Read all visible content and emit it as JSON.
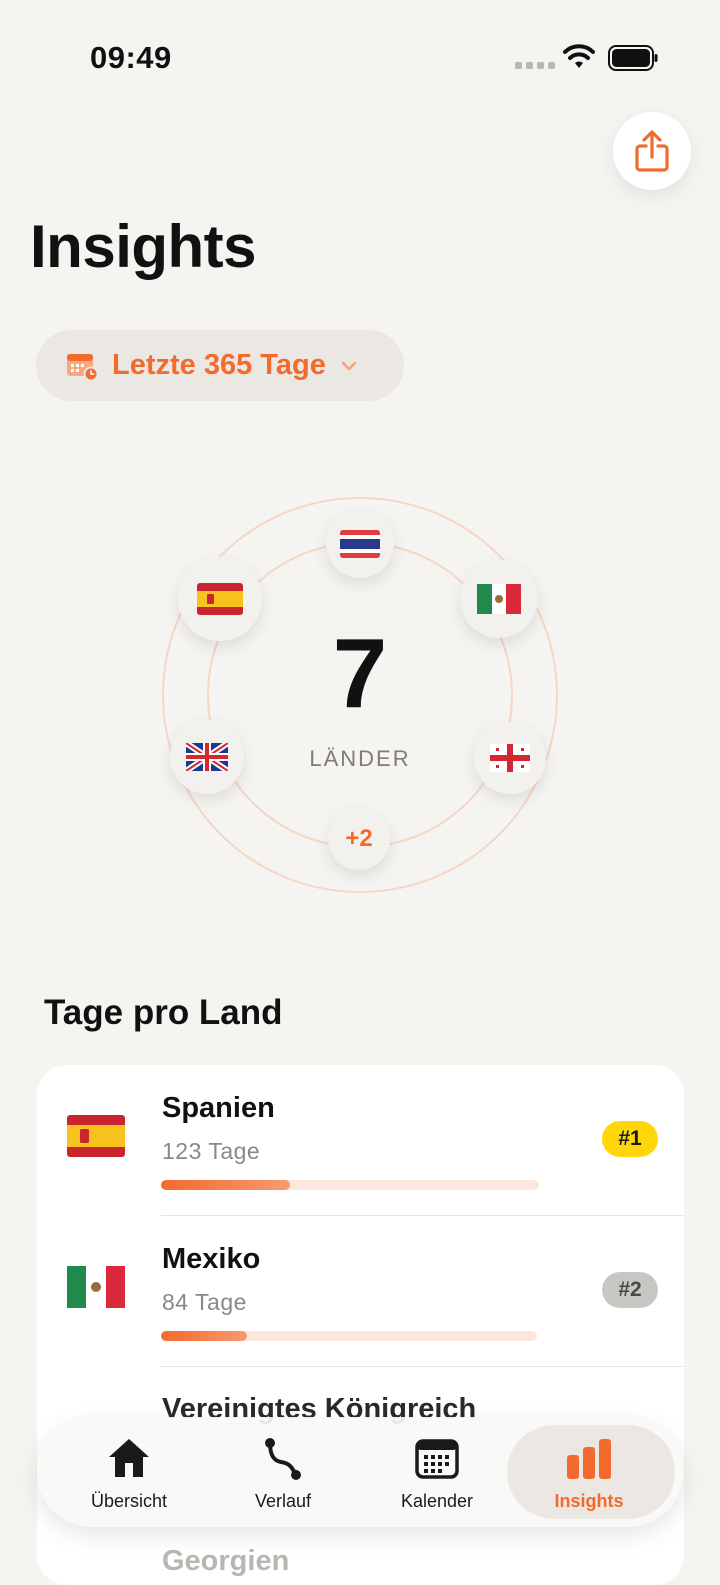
{
  "status_bar": {
    "time": "09:49"
  },
  "header": {
    "title": "Insights",
    "share_icon": "share-icon"
  },
  "range_picker": {
    "label": "Letzte 365 Tage",
    "icon": "calendar-clock-icon"
  },
  "countries_summary": {
    "count": "7",
    "label": "LÄNDER",
    "flags": [
      "Thailand",
      "Mexiko",
      "Georgien",
      "Spanien",
      "Vereinigtes Königreich"
    ],
    "more": "+2",
    "accent": "#f26b2c"
  },
  "days_per_country": {
    "title": "Tage pro Land",
    "rows": [
      {
        "name": "Spanien",
        "days": "123 Tage",
        "rank": "#1",
        "share": 0.34
      },
      {
        "name": "Mexiko",
        "days": "84 Tage",
        "rank": "#2",
        "share": 0.23
      }
    ],
    "peek": [
      "Vereinigtes Königreich",
      "Georgien"
    ]
  },
  "tab_bar": {
    "tabs": [
      {
        "label": "Übersicht",
        "icon": "house-icon"
      },
      {
        "label": "Verlauf",
        "icon": "route-icon"
      },
      {
        "label": "Kalender",
        "icon": "calendar-icon"
      },
      {
        "label": "Insights",
        "icon": "bar-chart-icon",
        "active": true
      }
    ]
  }
}
